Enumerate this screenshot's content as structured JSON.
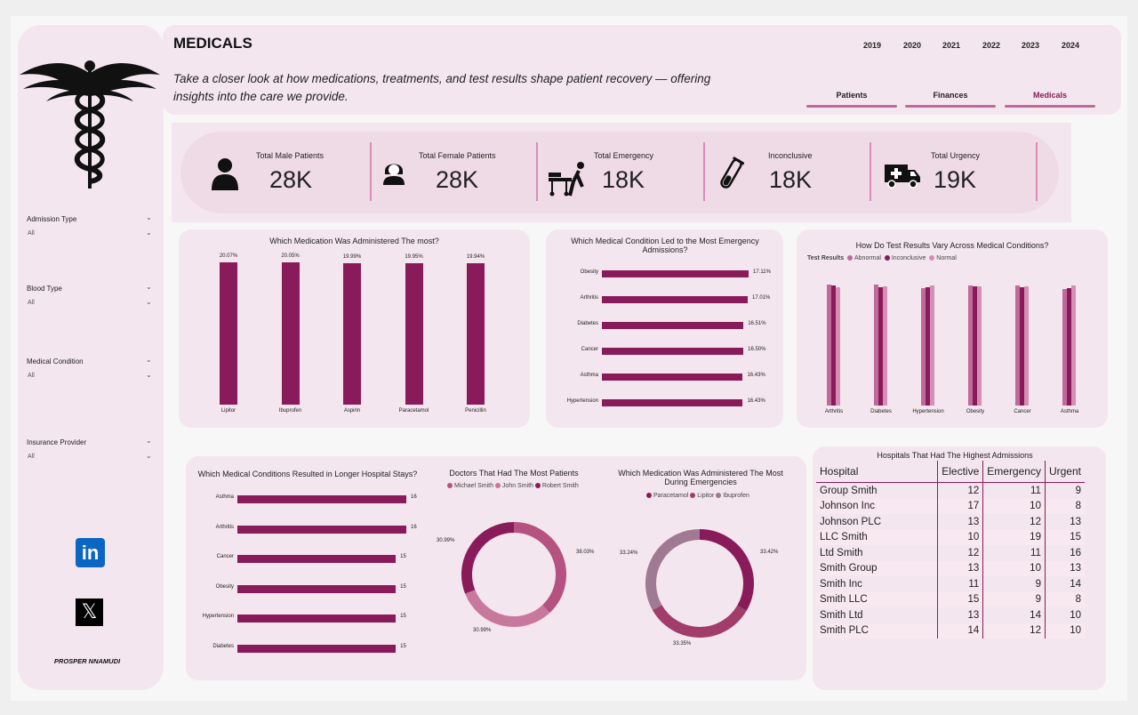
{
  "colors": {
    "bar": "#8a1b5a",
    "panel": "#f4e6ee",
    "abnormal": "#c06a9b",
    "inconclusive": "#8a1b5a",
    "normal": "#d58fb4"
  },
  "header": {
    "title": "MEDICALS",
    "subtitle_line1": "Take a closer look at how medications, treatments, and test results shape patient recovery — offering",
    "subtitle_line2": "insights into the care we provide.",
    "years": [
      "2019",
      "2020",
      "2021",
      "2022",
      "2023",
      "2024"
    ],
    "nav": [
      "Patients",
      "Finances",
      "Medicals"
    ],
    "active_nav": "Medicals"
  },
  "sidebar": {
    "logo_icon": "caduceus-icon",
    "filters": [
      {
        "label": "Admission Type",
        "value": "All"
      },
      {
        "label": "Blood Type",
        "value": "All"
      },
      {
        "label": "Medical Condition",
        "value": "All"
      },
      {
        "label": "Insurance Provider",
        "value": "All"
      }
    ],
    "social": [
      "linkedin-icon",
      "x-icon"
    ],
    "author": "PROSPER NNAMUDI"
  },
  "kpis": [
    {
      "label": "Total Male Patients",
      "value": "28K",
      "icon": "male-user-icon"
    },
    {
      "label": "Total Female Patients",
      "value": "28K",
      "icon": "female-user-icon"
    },
    {
      "label": "Total Emergency",
      "value": "18K",
      "icon": "stretcher-icon"
    },
    {
      "label": "Inconclusive",
      "value": "18K",
      "icon": "test-tube-icon"
    },
    {
      "label": "Total Urgency",
      "value": "19K",
      "icon": "ambulance-icon"
    }
  ],
  "chart_data": [
    {
      "id": "medication",
      "type": "bar",
      "title": "Which Medication Was Administered The most?",
      "categories": [
        "Lipitor",
        "Ibuprofen",
        "Aspirin",
        "Paracetamol",
        "Penicillin"
      ],
      "values": [
        20.07,
        20.05,
        19.99,
        19.95,
        19.94
      ],
      "value_labels": [
        "20.07%",
        "20.05%",
        "19.99%",
        "19.95%",
        "19.94%"
      ]
    },
    {
      "id": "emergency",
      "type": "bar",
      "orientation": "horizontal",
      "title": "Which Medical Condition Led to the Most Emergency Admissions?",
      "categories": [
        "Obesity",
        "Arthritis",
        "Diabetes",
        "Cancer",
        "Asthma",
        "Hypertension"
      ],
      "values": [
        17.11,
        17.01,
        16.51,
        16.5,
        16.43,
        16.43
      ],
      "value_labels": [
        "17.11%",
        "17.01%",
        "16.51%",
        "16.50%",
        "16.43%",
        "16.43%"
      ]
    },
    {
      "id": "testresults",
      "type": "bar",
      "title": "How Do Test Results Vary Across Medical Conditions?",
      "legend_title": "Test Results",
      "categories": [
        "Arthritis",
        "Diabetes",
        "Hypertension",
        "Obesity",
        "Cancer",
        "Asthma"
      ],
      "series": [
        {
          "name": "Abnormal",
          "values": [
            3110,
            3100,
            3020,
            3090,
            3080,
            3000
          ]
        },
        {
          "name": "Inconclusive",
          "values": [
            3080,
            3050,
            3050,
            3060,
            3050,
            3020
          ]
        },
        {
          "name": "Normal",
          "values": [
            3030,
            3060,
            3080,
            3060,
            3060,
            3090
          ]
        }
      ],
      "ylim": [
        0,
        3200
      ]
    },
    {
      "id": "stays",
      "type": "bar",
      "orientation": "horizontal",
      "title": "Which Medical Conditions Resulted in Longer Hospital Stays?",
      "categories": [
        "Asthma",
        "Arthritis",
        "Cancer",
        "Obesity",
        "Hypertension",
        "Diabetes"
      ],
      "values": [
        16,
        16,
        15,
        15,
        15,
        15
      ],
      "value_labels": [
        "16",
        "16",
        "15",
        "15",
        "15",
        "15"
      ]
    },
    {
      "id": "doctors",
      "type": "pie",
      "title": "Doctors That Had The Most Patients",
      "categories": [
        "Michael Smith",
        "John Smith",
        "Robert Smith"
      ],
      "values": [
        38.03,
        30.99,
        30.99
      ],
      "value_labels": [
        "38.03%",
        "30.99%",
        "30.99%"
      ],
      "colors": [
        "#b5527f",
        "#c8789d",
        "#8a1b5a"
      ]
    },
    {
      "id": "emergencymeds",
      "type": "pie",
      "title": "Which Medication Was Administered The Most During Emergencies",
      "categories": [
        "Paracetamol",
        "Lipitor",
        "Ibuprofen"
      ],
      "values": [
        33.42,
        33.35,
        33.24
      ],
      "value_labels": [
        "33.42%",
        "33.35%",
        "33.24%"
      ],
      "colors": [
        "#8a1b5a",
        "#a13c6b",
        "#a07a92"
      ]
    },
    {
      "id": "hospitals",
      "type": "table",
      "title": "Hospitals That Had The Highest Admissions",
      "columns": [
        "Hospital",
        "Elective",
        "Emergency",
        "Urgent"
      ],
      "rows": [
        [
          "Group Smith",
          "12",
          "11",
          "9"
        ],
        [
          "Johnson Inc",
          "17",
          "10",
          "8"
        ],
        [
          "Johnson PLC",
          "13",
          "12",
          "13"
        ],
        [
          "LLC Smith",
          "10",
          "19",
          "15"
        ],
        [
          "Ltd Smith",
          "12",
          "11",
          "16"
        ],
        [
          "Smith Group",
          "13",
          "10",
          "13"
        ],
        [
          "Smith Inc",
          "11",
          "9",
          "14"
        ],
        [
          "Smith LLC",
          "15",
          "9",
          "8"
        ],
        [
          "Smith Ltd",
          "13",
          "14",
          "10"
        ],
        [
          "Smith PLC",
          "14",
          "12",
          "10"
        ]
      ]
    }
  ]
}
